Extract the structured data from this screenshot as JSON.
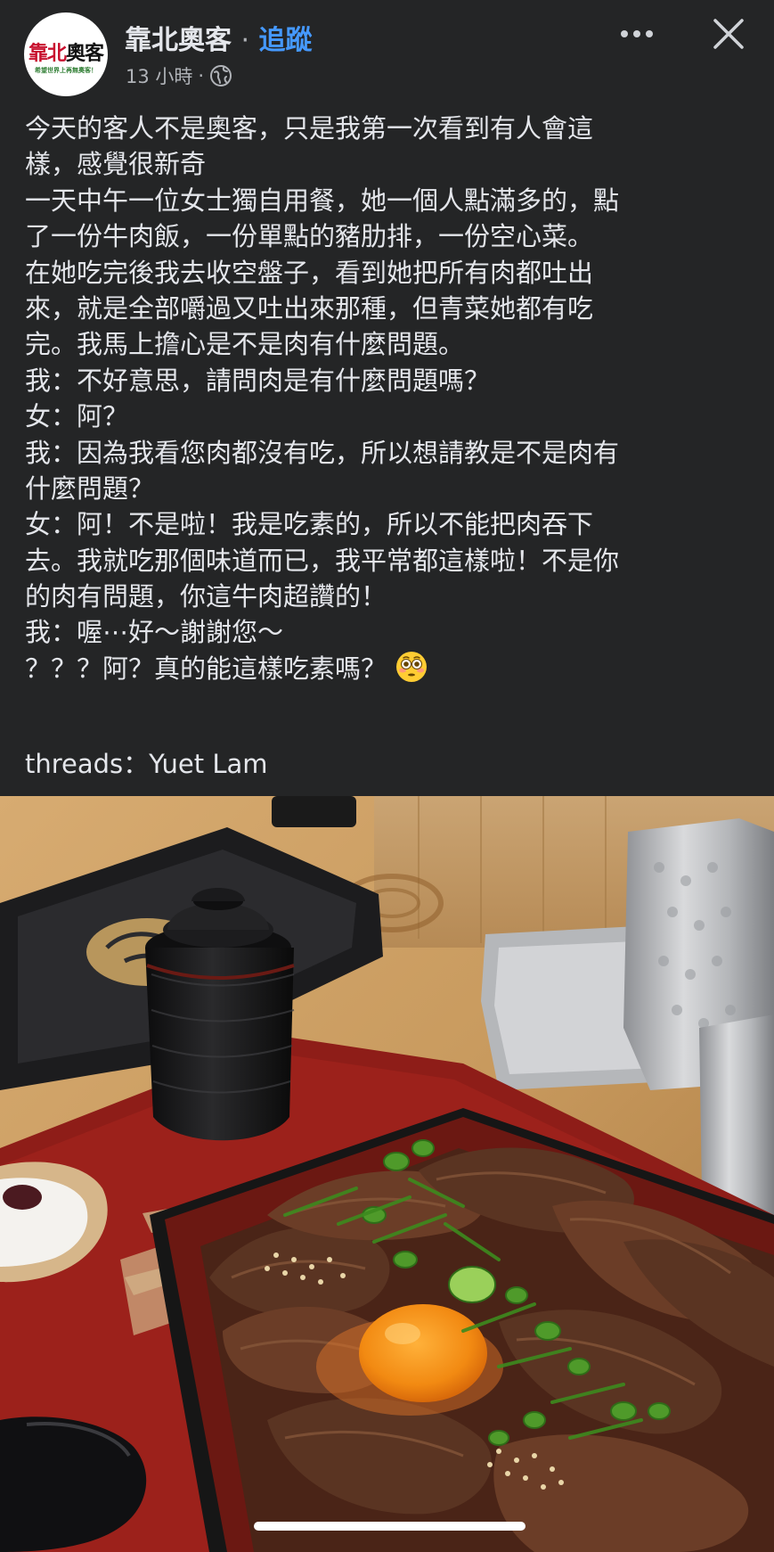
{
  "header": {
    "page_name": "靠北奧客",
    "separator": "·",
    "follow_label": "追蹤",
    "time": "13 小時",
    "time_separator": "·",
    "avatar": {
      "logo_red": "靠北",
      "logo_black": "奧客",
      "logo_tagline": "希望世界上再無奧客！"
    },
    "icons": [
      "more-options-icon",
      "close-icon",
      "globe-icon"
    ]
  },
  "post": {
    "lines": [
      "今天的客人不是奧客，只是我第一次看到有人會這",
      "樣，感覺很新奇",
      "一天中午一位女士獨自用餐，她一個人點滿多的，點",
      "了一份牛肉飯，一份單點的豬肋排，一份空心菜。",
      "在她吃完後我去收空盤子，看到她把所有肉都吐出",
      "來，就是全部嚼過又吐出來那種，但青菜她都有吃",
      "完。我馬上擔心是不是肉有什麼問題。",
      "我：不好意思，請問肉是有什麼問題嗎？",
      "女：阿？",
      "我：因為我看您肉都沒有吃，所以想請教是不是肉有",
      "什麼問題？",
      "女：阿！不是啦！我是吃素的，所以不能把肉吞下",
      "去。我就吃那個味道而已，我平常都這樣啦！不是你",
      "的肉有問題，你這牛肉超讚的！",
      "我：喔⋯好～謝謝您～",
      "？？？阿？真的能這樣吃素嗎？"
    ],
    "emoji": "flushed-face",
    "credit": "threads：Yuet Lam"
  },
  "photo": {
    "subject": "gyudon-with-egg-yolk",
    "colors": {
      "table": "#c89a5e",
      "tray": "#8e1d18",
      "box_inner": "#6b1812",
      "yolk": "#f28a12",
      "scallion": "#4f9a2a",
      "beef": "#5a3422"
    }
  },
  "colors": {
    "background": "#242526",
    "text": "#e4e6eb",
    "secondary": "#b0b3b8",
    "accent": "#4599ff"
  }
}
